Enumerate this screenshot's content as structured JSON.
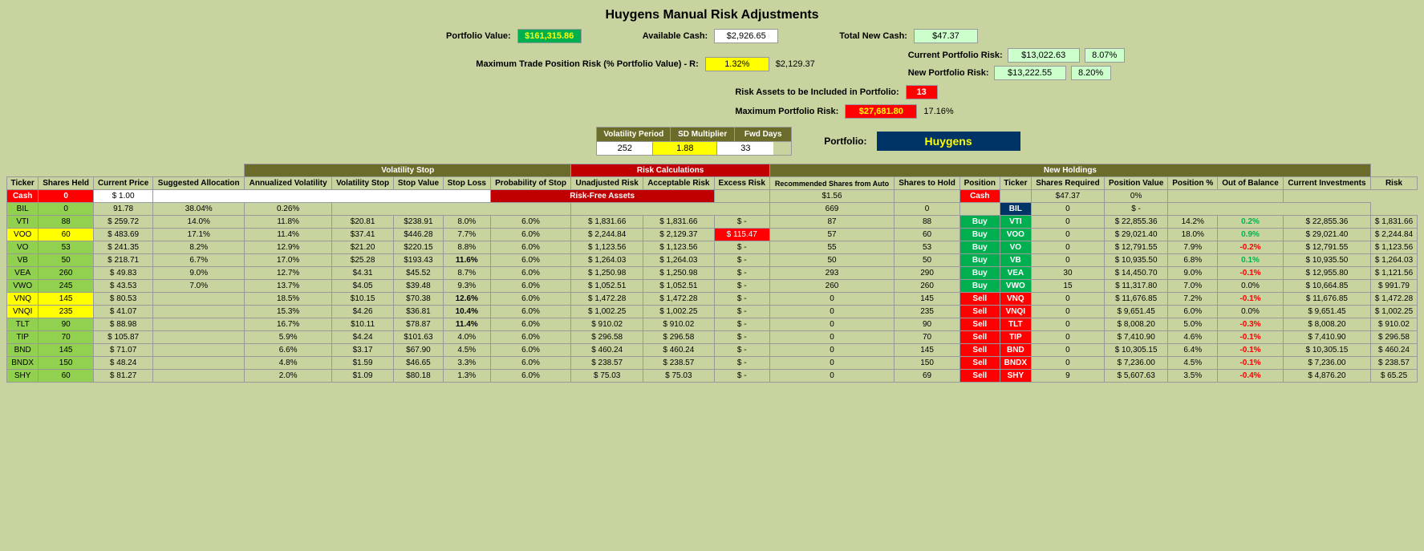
{
  "title": "Huygens Manual Risk Adjustments",
  "header": {
    "portfolio_value_label": "Portfolio Value:",
    "portfolio_value": "$161,315.86",
    "available_cash_label": "Available Cash:",
    "available_cash": "$2,926.65",
    "total_new_cash_label": "Total New Cash:",
    "total_new_cash": "$47.37",
    "max_trade_risk_label": "Maximum Trade Position Risk (% Portfolio Value) - R:",
    "max_trade_risk_pct": "1.32%",
    "max_trade_risk_val": "$2,129.37",
    "risk_assets_label": "Risk Assets to be Included in Portfolio:",
    "risk_assets_val": "13",
    "max_portfolio_risk_label": "Maximum Portfolio Risk:",
    "max_portfolio_risk": "$27,681.80",
    "max_portfolio_risk_pct": "17.16%",
    "current_portfolio_risk_label": "Current Portfolio Risk:",
    "current_portfolio_risk_val": "$13,022.63",
    "current_portfolio_risk_pct": "8.07%",
    "new_portfolio_risk_label": "New Portfolio Risk:",
    "new_portfolio_risk_val": "$13,222.55",
    "new_portfolio_risk_pct": "8.20%",
    "volatility_period_label": "Volatility Period",
    "sd_multiplier_label": "SD Multiplier",
    "fwd_days_label": "Fwd Days",
    "volatility_period_val": "252",
    "sd_multiplier_val": "1.88",
    "fwd_days_val": "33",
    "portfolio_label": "Portfolio:",
    "portfolio_name": "Huygens"
  },
  "table_headers": {
    "volatility_stop": "Volatility Stop",
    "risk_calculations": "Risk Calculations",
    "new_holdings": "New Holdings",
    "col_ticker": "Ticker",
    "col_shares_held": "Shares Held",
    "col_current_price": "Current Price",
    "col_suggested_allocation": "Suggested Allocation",
    "col_annualized_volatility": "Annualized Volatility",
    "col_volatility_stop": "Volatility Stop",
    "col_stop_value": "Stop Value",
    "col_stop_loss": "Stop Loss",
    "col_prob_stop": "Probability of Stop",
    "col_unadjusted_risk": "Unadjusted Risk",
    "col_acceptable_risk": "Acceptable Risk",
    "col_excess_risk": "Excess Risk",
    "col_recommended_shares": "Recommended Shares from Auto",
    "col_shares_to_hold": "Shares to Hold",
    "col_position": "Position",
    "col_ticker2": "Ticker",
    "col_shares_required": "Shares Required",
    "col_position_value": "Position Value",
    "col_position_pct": "Position %",
    "col_out_of_balance": "Out of Balance",
    "col_current_investments": "Current Investments",
    "col_risk": "Risk"
  },
  "special_rows": {
    "cash_label": "Cash",
    "cash_shares": "0",
    "cash_price": "1.00",
    "cash_risk_free": "Risk-Free Assets",
    "cash_rec_val": "$1.56",
    "cash_new_ticker": "Cash",
    "cash_new_shares_req": "$47.37",
    "cash_new_pos_pct": "0%",
    "bil_label": "BIL",
    "bil_shares": "0",
    "bil_price": "91.78",
    "bil_alloc": "38.04%",
    "bil_vol": "0.26%",
    "bil_rec": "669",
    "bil_shares_hold": "0",
    "bil_new_ticker": "BIL",
    "bil_new_shares_req": "0",
    "bil_new_pos_val": "$  -"
  },
  "rows": [
    {
      "ticker": "VTI",
      "shares_held": "88",
      "current_price": "$ 259.72",
      "suggested_alloc": "14.0%",
      "ann_vol": "11.8%",
      "vol_stop": "$20.81",
      "stop_value": "$238.91",
      "stop_loss": "8.0%",
      "prob_stop": "6.0%",
      "unadj_risk": "$  1,831.66",
      "accept_risk": "$  1,831.66",
      "excess_risk": "$  -",
      "rec_shares": "87",
      "shares_hold": "88",
      "position": "Buy",
      "new_ticker": "VTI",
      "shares_req": "0",
      "pos_value": "$ 22,855.36",
      "pos_pct": "14.2%",
      "out_balance": "0.2%",
      "cur_investments": "$ 22,855.36",
      "risk": "$  1,831.66",
      "row_class": "row-vti",
      "pos_class": "buy-cell",
      "new_ticker_class": "ticker-vti",
      "excess_class": "",
      "out_balance_class": "pos-positive"
    },
    {
      "ticker": "VOO",
      "shares_held": "60",
      "current_price": "$ 483.69",
      "suggested_alloc": "17.1%",
      "ann_vol": "11.4%",
      "vol_stop": "$37.41",
      "stop_value": "$446.28",
      "stop_loss": "7.7%",
      "prob_stop": "6.0%",
      "unadj_risk": "$  2,244.84",
      "accept_risk": "$  2,129.37",
      "excess_risk": "$  115.47",
      "rec_shares": "57",
      "shares_hold": "60",
      "position": "Buy",
      "new_ticker": "VOO",
      "shares_req": "0",
      "pos_value": "$ 29,021.40",
      "pos_pct": "18.0%",
      "out_balance": "0.9%",
      "cur_investments": "$ 29,021.40",
      "risk": "$  2,244.84",
      "row_class": "row-voo",
      "pos_class": "buy-cell",
      "new_ticker_class": "ticker-voo",
      "excess_class": "cell-red-value",
      "out_balance_class": "pos-positive"
    },
    {
      "ticker": "VO",
      "shares_held": "53",
      "current_price": "$ 241.35",
      "suggested_alloc": "8.2%",
      "ann_vol": "12.9%",
      "vol_stop": "$21.20",
      "stop_value": "$220.15",
      "stop_loss": "8.8%",
      "prob_stop": "6.0%",
      "unadj_risk": "$  1,123.56",
      "accept_risk": "$  1,123.56",
      "excess_risk": "$  -",
      "rec_shares": "55",
      "shares_hold": "53",
      "position": "Buy",
      "new_ticker": "VO",
      "shares_req": "0",
      "pos_value": "$ 12,791.55",
      "pos_pct": "7.9%",
      "out_balance": "-0.2%",
      "cur_investments": "$ 12,791.55",
      "risk": "$  1,123.56",
      "row_class": "row-vo",
      "pos_class": "buy-cell",
      "new_ticker_class": "ticker-vo",
      "excess_class": "",
      "out_balance_class": "pos-negative"
    },
    {
      "ticker": "VB",
      "shares_held": "50",
      "current_price": "$ 218.71",
      "suggested_alloc": "6.7%",
      "ann_vol": "17.0%",
      "vol_stop": "$25.28",
      "stop_value": "$193.43",
      "stop_loss": "11.6%",
      "prob_stop": "6.0%",
      "unadj_risk": "$  1,264.03",
      "accept_risk": "$  1,264.03",
      "excess_risk": "$  -",
      "rec_shares": "50",
      "shares_hold": "50",
      "position": "Buy",
      "new_ticker": "VB",
      "shares_req": "0",
      "pos_value": "$ 10,935.50",
      "pos_pct": "6.8%",
      "out_balance": "0.1%",
      "cur_investments": "$ 10,935.50",
      "risk": "$  1,264.03",
      "row_class": "row-vb",
      "pos_class": "buy-cell",
      "new_ticker_class": "ticker-vb",
      "excess_class": "",
      "out_balance_class": "pos-positive"
    },
    {
      "ticker": "VEA",
      "shares_held": "260",
      "current_price": "$ 49.83",
      "suggested_alloc": "9.0%",
      "ann_vol": "12.7%",
      "vol_stop": "$4.31",
      "stop_value": "$45.52",
      "stop_loss": "8.7%",
      "prob_stop": "6.0%",
      "unadj_risk": "$  1,250.98",
      "accept_risk": "$  1,250.98",
      "excess_risk": "$  -",
      "rec_shares": "293",
      "shares_hold": "290",
      "position": "Buy",
      "new_ticker": "VEA",
      "shares_req": "30",
      "pos_value": "$ 14,450.70",
      "pos_pct": "9.0%",
      "out_balance": "-0.1%",
      "cur_investments": "$ 12,955.80",
      "risk": "$  1,121.56",
      "row_class": "row-vea",
      "pos_class": "buy-cell",
      "new_ticker_class": "ticker-vea",
      "excess_class": "",
      "out_balance_class": "pos-negative"
    },
    {
      "ticker": "VWO",
      "shares_held": "245",
      "current_price": "$ 43.53",
      "suggested_alloc": "7.0%",
      "ann_vol": "13.7%",
      "vol_stop": "$4.05",
      "stop_value": "$39.48",
      "stop_loss": "9.3%",
      "prob_stop": "6.0%",
      "unadj_risk": "$  1,052.51",
      "accept_risk": "$  1,052.51",
      "excess_risk": "$  -",
      "rec_shares": "260",
      "shares_hold": "260",
      "position": "Buy",
      "new_ticker": "VWO",
      "shares_req": "15",
      "pos_value": "$ 11,317.80",
      "pos_pct": "7.0%",
      "out_balance": "0.0%",
      "cur_investments": "$ 10,664.85",
      "risk": "$  991.79",
      "row_class": "row-vwo",
      "pos_class": "buy-cell",
      "new_ticker_class": "ticker-vwo",
      "excess_class": "",
      "out_balance_class": ""
    },
    {
      "ticker": "VNQ",
      "shares_held": "145",
      "current_price": "$ 80.53",
      "suggested_alloc": "",
      "ann_vol": "18.5%",
      "vol_stop": "$10.15",
      "stop_value": "$70.38",
      "stop_loss": "12.6%",
      "prob_stop": "6.0%",
      "unadj_risk": "$  1,472.28",
      "accept_risk": "$  1,472.28",
      "excess_risk": "$  -",
      "rec_shares": "0",
      "shares_hold": "145",
      "position": "Sell",
      "new_ticker": "VNQ",
      "shares_req": "0",
      "pos_value": "$ 11,676.85",
      "pos_pct": "7.2%",
      "out_balance": "-0.1%",
      "cur_investments": "$ 11,676.85",
      "risk": "$  1,472.28",
      "row_class": "row-vnq",
      "pos_class": "sell-cell",
      "new_ticker_class": "ticker-vnq",
      "excess_class": "",
      "out_balance_class": "pos-negative"
    },
    {
      "ticker": "VNQI",
      "shares_held": "235",
      "current_price": "$ 41.07",
      "suggested_alloc": "",
      "ann_vol": "15.3%",
      "vol_stop": "$4.26",
      "stop_value": "$36.81",
      "stop_loss": "10.4%",
      "prob_stop": "6.0%",
      "unadj_risk": "$  1,002.25",
      "accept_risk": "$  1,002.25",
      "excess_risk": "$  -",
      "rec_shares": "0",
      "shares_hold": "235",
      "position": "Sell",
      "new_ticker": "VNQI",
      "shares_req": "0",
      "pos_value": "$ 9,651.45",
      "pos_pct": "6.0%",
      "out_balance": "0.0%",
      "cur_investments": "$ 9,651.45",
      "risk": "$  1,002.25",
      "row_class": "row-vnqi",
      "pos_class": "sell-cell",
      "new_ticker_class": "ticker-vnqi",
      "excess_class": "",
      "out_balance_class": ""
    },
    {
      "ticker": "TLT",
      "shares_held": "90",
      "current_price": "$ 88.98",
      "suggested_alloc": "",
      "ann_vol": "16.7%",
      "vol_stop": "$10.11",
      "stop_value": "$78.87",
      "stop_loss": "11.4%",
      "prob_stop": "6.0%",
      "unadj_risk": "$  910.02",
      "accept_risk": "$  910.02",
      "excess_risk": "$  -",
      "rec_shares": "0",
      "shares_hold": "90",
      "position": "Sell",
      "new_ticker": "TLT",
      "shares_req": "0",
      "pos_value": "$ 8,008.20",
      "pos_pct": "5.0%",
      "out_balance": "-0.3%",
      "cur_investments": "$ 8,008.20",
      "risk": "$  910.02",
      "row_class": "row-tlt",
      "pos_class": "sell-cell",
      "new_ticker_class": "ticker-tlt",
      "excess_class": "",
      "out_balance_class": "pos-negative"
    },
    {
      "ticker": "TIP",
      "shares_held": "70",
      "current_price": "$ 105.87",
      "suggested_alloc": "",
      "ann_vol": "5.9%",
      "vol_stop": "$4.24",
      "stop_value": "$101.63",
      "stop_loss": "4.0%",
      "prob_stop": "6.0%",
      "unadj_risk": "$  296.58",
      "accept_risk": "$  296.58",
      "excess_risk": "$  -",
      "rec_shares": "0",
      "shares_hold": "70",
      "position": "Sell",
      "new_ticker": "TIP",
      "shares_req": "0",
      "pos_value": "$ 7,410.90",
      "pos_pct": "4.6%",
      "out_balance": "-0.1%",
      "cur_investments": "$ 7,410.90",
      "risk": "$  296.58",
      "row_class": "row-tip",
      "pos_class": "sell-cell",
      "new_ticker_class": "ticker-tip",
      "excess_class": "",
      "out_balance_class": "pos-negative"
    },
    {
      "ticker": "BND",
      "shares_held": "145",
      "current_price": "$ 71.07",
      "suggested_alloc": "",
      "ann_vol": "6.6%",
      "vol_stop": "$3.17",
      "stop_value": "$67.90",
      "stop_loss": "4.5%",
      "prob_stop": "6.0%",
      "unadj_risk": "$  460.24",
      "accept_risk": "$  460.24",
      "excess_risk": "$  -",
      "rec_shares": "0",
      "shares_hold": "145",
      "position": "Sell",
      "new_ticker": "BND",
      "shares_req": "0",
      "pos_value": "$ 10,305.15",
      "pos_pct": "6.4%",
      "out_balance": "-0.1%",
      "cur_investments": "$ 10,305.15",
      "risk": "$  460.24",
      "row_class": "row-bnd",
      "pos_class": "sell-cell",
      "new_ticker_class": "ticker-bnd",
      "excess_class": "",
      "out_balance_class": "pos-negative"
    },
    {
      "ticker": "BNDX",
      "shares_held": "150",
      "current_price": "$ 48.24",
      "suggested_alloc": "",
      "ann_vol": "4.8%",
      "vol_stop": "$1.59",
      "stop_value": "$46.65",
      "stop_loss": "3.3%",
      "prob_stop": "6.0%",
      "unadj_risk": "$  238.57",
      "accept_risk": "$  238.57",
      "excess_risk": "$  -",
      "rec_shares": "0",
      "shares_hold": "150",
      "position": "Sell",
      "new_ticker": "BNDX",
      "shares_req": "0",
      "pos_value": "$ 7,236.00",
      "pos_pct": "4.5%",
      "out_balance": "-0.1%",
      "cur_investments": "$ 7,236.00",
      "risk": "$  238.57",
      "row_class": "row-bndx",
      "pos_class": "sell-cell",
      "new_ticker_class": "ticker-bndx",
      "excess_class": "",
      "out_balance_class": "pos-negative"
    },
    {
      "ticker": "SHY",
      "shares_held": "60",
      "current_price": "$ 81.27",
      "suggested_alloc": "",
      "ann_vol": "2.0%",
      "vol_stop": "$1.09",
      "stop_value": "$80.18",
      "stop_loss": "1.3%",
      "prob_stop": "6.0%",
      "unadj_risk": "$  75.03",
      "accept_risk": "$  75.03",
      "excess_risk": "$  -",
      "rec_shares": "0",
      "shares_hold": "69",
      "position": "Sell",
      "new_ticker": "SHY",
      "shares_req": "9",
      "pos_value": "$ 5,607.63",
      "pos_pct": "3.5%",
      "out_balance": "-0.4%",
      "cur_investments": "$ 4,876.20",
      "risk": "$  65.25",
      "row_class": "row-shy",
      "pos_class": "sell-cell",
      "new_ticker_class": "ticker-shy",
      "excess_class": "",
      "out_balance_class": "pos-negative"
    }
  ]
}
